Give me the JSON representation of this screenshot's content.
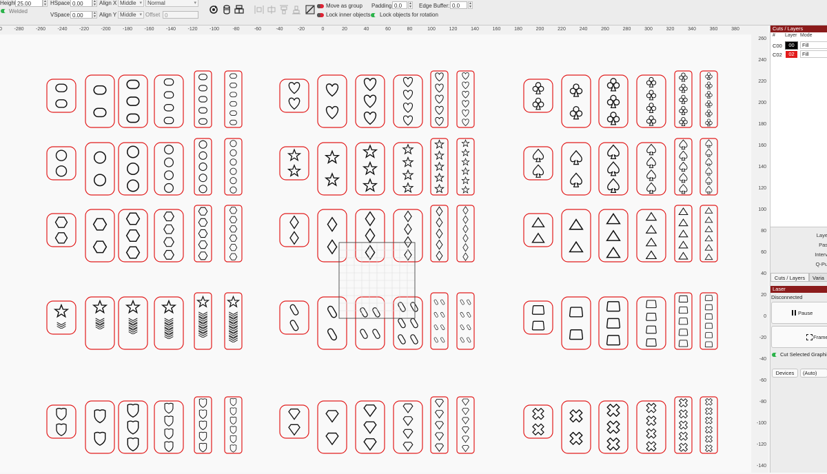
{
  "toolbar": {
    "height_label": "Height",
    "height_value": "25.00",
    "welded_label": "Welded",
    "hspace_label": "HSpace",
    "hspace_value": "0.00",
    "vspace_label": "VSpace",
    "vspace_value": "0.00",
    "alignx_label": "Align X",
    "alignx_value": "Middle",
    "aligny_label": "Align Y",
    "aligny_value": "Middle",
    "mode_value": "Normal",
    "offset_label": "Offset",
    "offset_value": "0",
    "move_group_label": "Move as group",
    "lock_inner_label": "Lock inner objects",
    "lock_rotation_label": "Lock objects for rotation",
    "padding_label": "Padding:",
    "padding_value": "0.0",
    "edge_buffer_label": "Edge Buffer:",
    "edge_buffer_value": "0.0"
  },
  "ruler": {
    "top_ticks": [
      "-300",
      "-280",
      "-260",
      "-240",
      "-220",
      "-200",
      "-180",
      "-160",
      "-140",
      "-120",
      "-100",
      "-80",
      "-60",
      "-40",
      "-20",
      "0",
      "20",
      "40",
      "60",
      "80",
      "100",
      "120",
      "140",
      "160",
      "180",
      "200",
      "220",
      "240",
      "260",
      "280",
      "300",
      "320",
      "340",
      "360",
      "380"
    ],
    "right_ticks": [
      "260",
      "240",
      "220",
      "200",
      "180",
      "160",
      "140",
      "120",
      "100",
      "80",
      "60",
      "40",
      "20",
      "0",
      "-20",
      "-40",
      "-60",
      "-80",
      "-100",
      "-120",
      "-140"
    ]
  },
  "cuts_panel": {
    "title": "Cuts / Layers",
    "col_num": "#",
    "col_layer": "Layer",
    "col_mode": "Mode",
    "rows": [
      {
        "name": "C00",
        "layer": "00",
        "mode": "Fill",
        "color": "#000000"
      },
      {
        "name": "C02",
        "layer": "02",
        "mode": "Fill",
        "color": "#e21b1b"
      }
    ],
    "settings": [
      "Laye",
      "Pas",
      "Interv",
      "Q-Pu"
    ],
    "tab_cuts": "Cuts / Layers",
    "tab_vars": "Varia"
  },
  "laser_panel": {
    "title": "Laser",
    "status": "Disconnected",
    "pause_label": "Pause",
    "frame_label": "Frame",
    "cut_selected_label": "Cut Selected Graphi",
    "devices_label": "Devices",
    "auto_label": "(Auto)"
  },
  "colors": {
    "outline": "#e21b1b",
    "shape": "#111111",
    "panel_header": "#8b1b1b"
  },
  "design": {
    "sets": [
      {
        "shape": "oval-icon",
        "counts": [
          2,
          2,
          3,
          4,
          5,
          6
        ]
      },
      {
        "shape": "heart-icon",
        "counts": [
          2,
          2,
          3,
          4,
          5,
          6
        ]
      },
      {
        "shape": "club-icon",
        "counts": [
          2,
          2,
          3,
          4,
          5,
          6
        ]
      },
      {
        "shape": "circle-icon",
        "counts": [
          2,
          2,
          3,
          4,
          5,
          6
        ]
      },
      {
        "shape": "star-icon",
        "counts": [
          2,
          2,
          3,
          4,
          5,
          6
        ]
      },
      {
        "shape": "spade-icon",
        "counts": [
          2,
          2,
          3,
          4,
          5,
          6
        ]
      },
      {
        "shape": "hexagon-icon",
        "counts": [
          2,
          2,
          3,
          4,
          5,
          6
        ]
      },
      {
        "shape": "diamond-icon",
        "counts": [
          2,
          2,
          3,
          4,
          5,
          6
        ]
      },
      {
        "shape": "triangle-icon",
        "counts": [
          2,
          2,
          3,
          4,
          5,
          6
        ]
      },
      {
        "shape": "chevron-star-icon",
        "counts": [
          2,
          3,
          4,
          5,
          6,
          6
        ]
      },
      {
        "shape": "pill-icon",
        "counts": [
          2,
          2,
          4,
          6,
          8,
          8
        ]
      },
      {
        "shape": "trapezoid-icon",
        "counts": [
          2,
          2,
          3,
          4,
          5,
          6
        ]
      },
      {
        "shape": "shield-icon",
        "counts": [
          2,
          2,
          3,
          4,
          5,
          6
        ]
      },
      {
        "shape": "gem-icon",
        "counts": [
          2,
          2,
          3,
          4,
          5,
          6
        ]
      },
      {
        "shape": "cross-icon",
        "counts": [
          2,
          2,
          3,
          4,
          5,
          6
        ]
      }
    ]
  }
}
